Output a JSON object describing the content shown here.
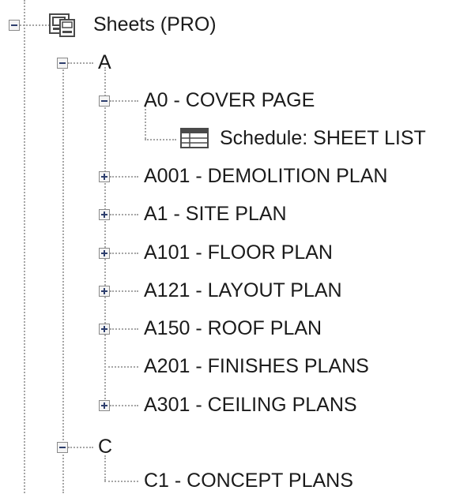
{
  "tree": {
    "root": {
      "label": "Sheets (PRO)",
      "icon": "sheet-icon",
      "expanded": true
    },
    "groups": [
      {
        "label": "A",
        "expanded": true,
        "items": [
          {
            "label": "A0 - COVER PAGE",
            "expanded": true,
            "children": [
              {
                "label": "Schedule: SHEET LIST",
                "icon": "schedule-icon"
              }
            ]
          },
          {
            "label": "A001 - DEMOLITION PLAN",
            "expanded": false
          },
          {
            "label": "A1 - SITE PLAN",
            "expanded": false
          },
          {
            "label": "A101 - FLOOR PLAN",
            "expanded": false
          },
          {
            "label": "A121 - LAYOUT PLAN",
            "expanded": false
          },
          {
            "label": "A150 - ROOF PLAN",
            "expanded": false
          },
          {
            "label": "A201 - FINISHES PLANS"
          },
          {
            "label": "A301 - CEILING PLANS",
            "expanded": false
          }
        ]
      },
      {
        "label": "C",
        "expanded": true,
        "items": [
          {
            "label": "C1 - CONCEPT PLANS"
          }
        ]
      }
    ]
  }
}
